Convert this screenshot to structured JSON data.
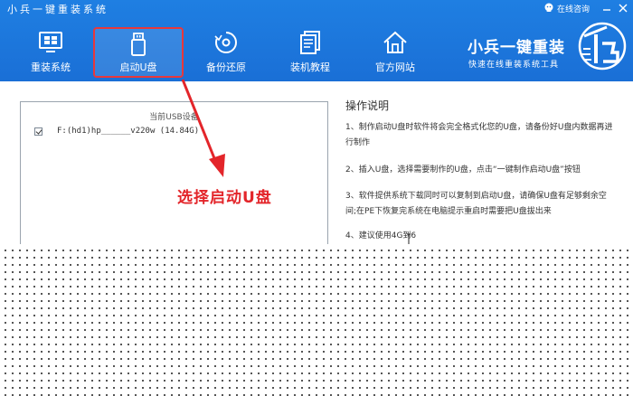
{
  "window": {
    "title": "小兵一键重装系统",
    "online_help": "在线咨询"
  },
  "nav": {
    "reinstall": "重装系统",
    "usb_boot": "启动U盘",
    "backup": "备份还原",
    "tutorial": "装机教程",
    "website": "官方网站"
  },
  "brand": {
    "name": "小兵一键重装",
    "slogan": "快速在线重装系统工具"
  },
  "device_list": {
    "header": "当前USB设备",
    "items": [
      {
        "label": "F:(hd1)hp______v220w (14.84G)",
        "checked": true
      }
    ]
  },
  "annotation": "选择启动U盘",
  "instructions": {
    "title": "操作说明",
    "steps": [
      "1、制作启动U盘时软件将会完全格式化您的U盘，请备份好U盘内数据再进行制作",
      "2、插入U盘，选择需要制作的U盘，点击“一键制作启动U盘”按钮",
      "3、软件提供系统下载同时可以复制到启动U盘，请确保U盘有足够剩余空间;在PE下恢复完系统在电脑提示重启时需要把U盘拔出来",
      "4、建议使用4G到6"
    ]
  },
  "colors": {
    "header_blue": "#1a72da",
    "highlight_red": "#e3252a"
  }
}
